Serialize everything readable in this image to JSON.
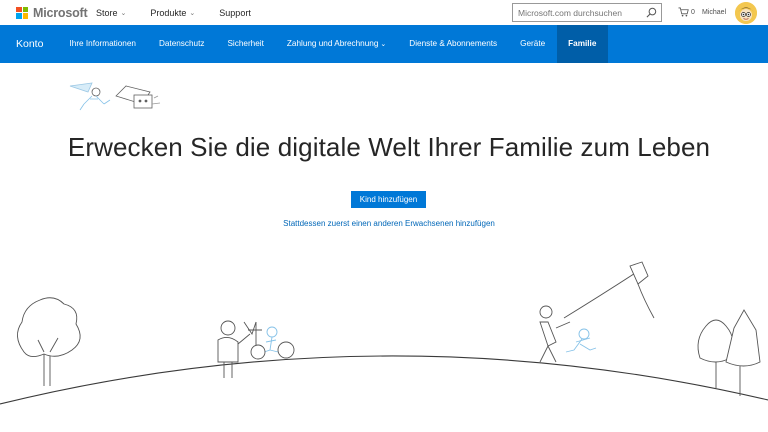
{
  "header": {
    "brand": "Microsoft",
    "brand_colors": [
      "#f25022",
      "#7fba00",
      "#00a4ef",
      "#ffb900"
    ],
    "nav": [
      {
        "label": "Store",
        "dropdown": true
      },
      {
        "label": "Produkte",
        "dropdown": true
      },
      {
        "label": "Support",
        "dropdown": false
      }
    ],
    "search_placeholder": "Microsoft.com durchsuchen",
    "cart_count": "0",
    "user_name": "Michael"
  },
  "account_nav": {
    "title": "Konto",
    "tabs": [
      {
        "label": "Ihre Informationen",
        "active": false,
        "dropdown": false
      },
      {
        "label": "Datenschutz",
        "active": false,
        "dropdown": false
      },
      {
        "label": "Sicherheit",
        "active": false,
        "dropdown": false
      },
      {
        "label": "Zahlung und Abrechnung",
        "active": false,
        "dropdown": true
      },
      {
        "label": "Dienste & Abonnements",
        "active": false,
        "dropdown": false
      },
      {
        "label": "Geräte",
        "active": false,
        "dropdown": false
      },
      {
        "label": "Familie",
        "active": true,
        "dropdown": false
      }
    ],
    "bar_color": "#0078d7",
    "active_color": "#005ea8"
  },
  "main": {
    "headline": "Erwecken Sie die digitale Welt Ihrer Familie zum Leben",
    "primary_button": "Kind hinzufügen",
    "secondary_link": "Stattdessen zuerst einen anderen Erwachsenen hinzufügen"
  },
  "colors": {
    "accent": "#0078d7",
    "link": "#0067b8",
    "illustration_blue": "#9fd2f0"
  }
}
